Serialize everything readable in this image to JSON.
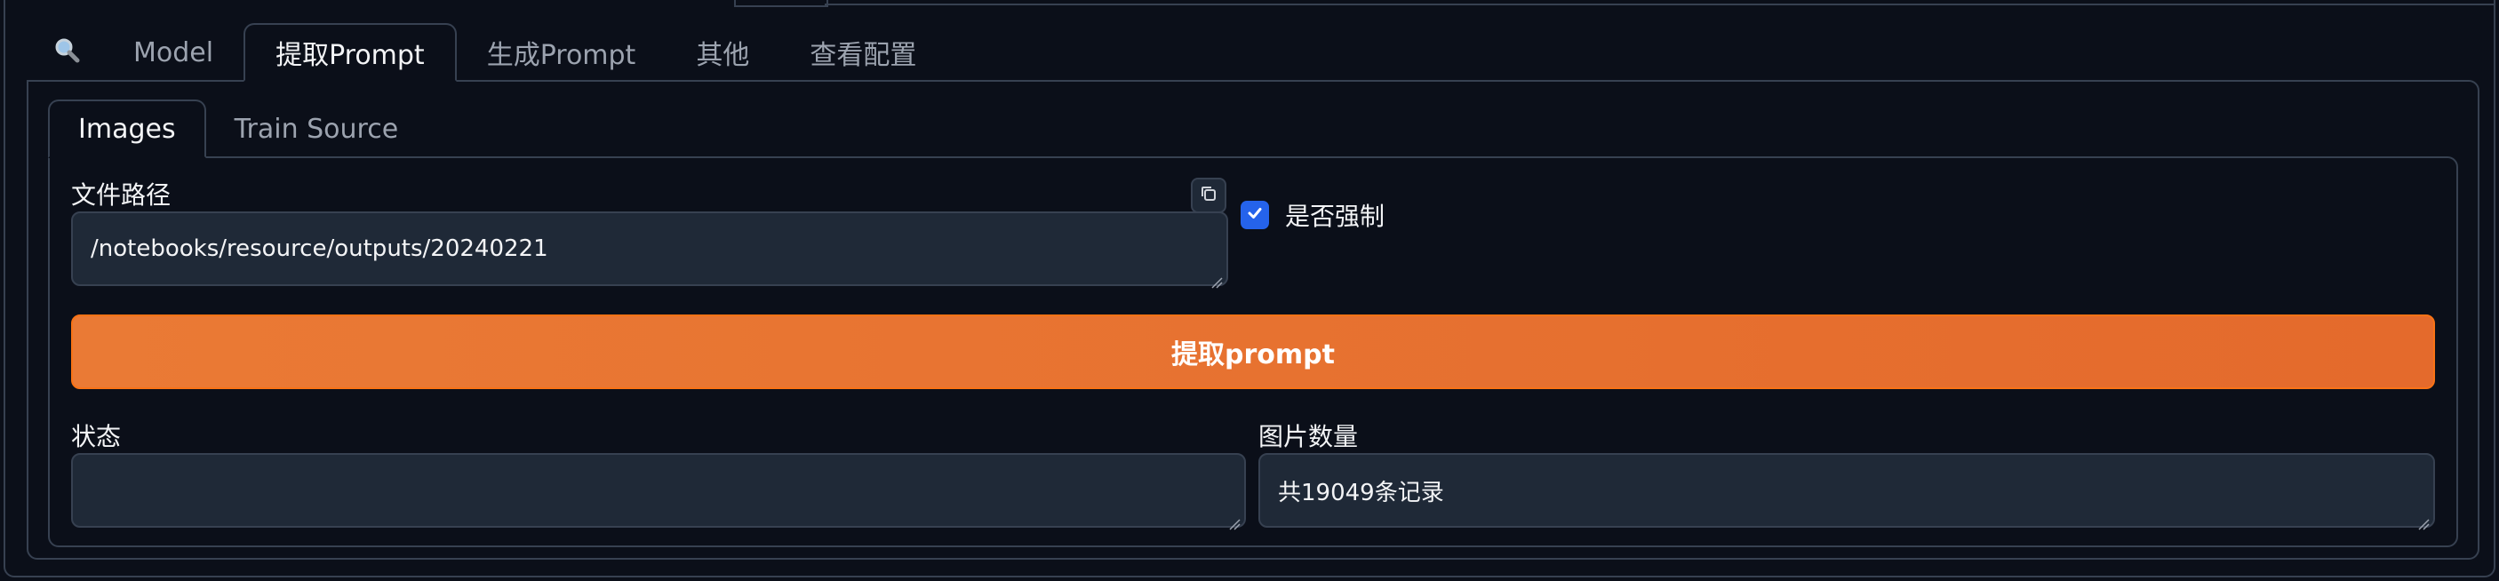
{
  "top_tabs": {
    "search_icon": "search-icon",
    "model": "Model",
    "extract_prompt": "提取Prompt",
    "generate_prompt": "生成Prompt",
    "other": "其他",
    "view_config": "查看配置"
  },
  "inner_tabs": {
    "images": "Images",
    "train_source": "Train Source"
  },
  "file_path": {
    "label": "文件路径",
    "value": "/notebooks/resource/outputs/20240221"
  },
  "force": {
    "label": "是否强制",
    "checked": true
  },
  "extract_button": {
    "label": "提取prompt"
  },
  "status": {
    "label": "状态",
    "value": ""
  },
  "image_count": {
    "label": "图片数量",
    "value": "共19049条记录"
  },
  "colors": {
    "background": "#0b0f19",
    "border": "#374151",
    "input_bg": "#1f2937",
    "accent_orange": "#e46a2c",
    "checkbox_blue": "#2563eb"
  }
}
